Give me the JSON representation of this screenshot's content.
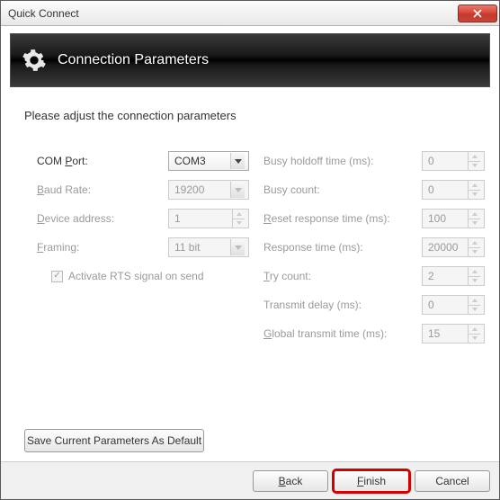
{
  "window": {
    "title": "Quick Connect"
  },
  "banner": {
    "title": "Connection Parameters"
  },
  "instruction": "Please adjust the connection parameters",
  "left": {
    "com_port": {
      "label": "COM ",
      "label_u": "P",
      "label_after": "ort:",
      "value": "COM3"
    },
    "baud_rate": {
      "label_u": "B",
      "label": "aud Rate:",
      "value": "19200"
    },
    "device_addr": {
      "label_u": "D",
      "label": "evice address:",
      "value": "1"
    },
    "framing": {
      "label_u": "F",
      "label": "raming:",
      "value": "11 bit"
    },
    "activate_rts": {
      "label": "Activate RTS signal on send",
      "checked": true
    }
  },
  "right": {
    "busy_holdoff": {
      "label": "Busy holdoff time (ms):",
      "value": "0"
    },
    "busy_count": {
      "label": "Busy count:",
      "value": "0"
    },
    "reset_response": {
      "label_u": "R",
      "label": "eset response time (ms):",
      "value": "100"
    },
    "response_time": {
      "label": "Response time (ms):",
      "value": "20000"
    },
    "try_count": {
      "label_u": "T",
      "label": "ry count:",
      "value": "2"
    },
    "transmit_delay": {
      "label": "Transmit delay (ms):",
      "value": "0"
    },
    "global_transmit": {
      "label_u": "G",
      "label": "lobal transmit time (ms):",
      "value": "15"
    }
  },
  "buttons": {
    "save_default": "Save Current Parameters As Default",
    "back": "ack",
    "back_u": "B",
    "finish": "inish",
    "finish_u": "F",
    "cancel": "Cancel"
  }
}
